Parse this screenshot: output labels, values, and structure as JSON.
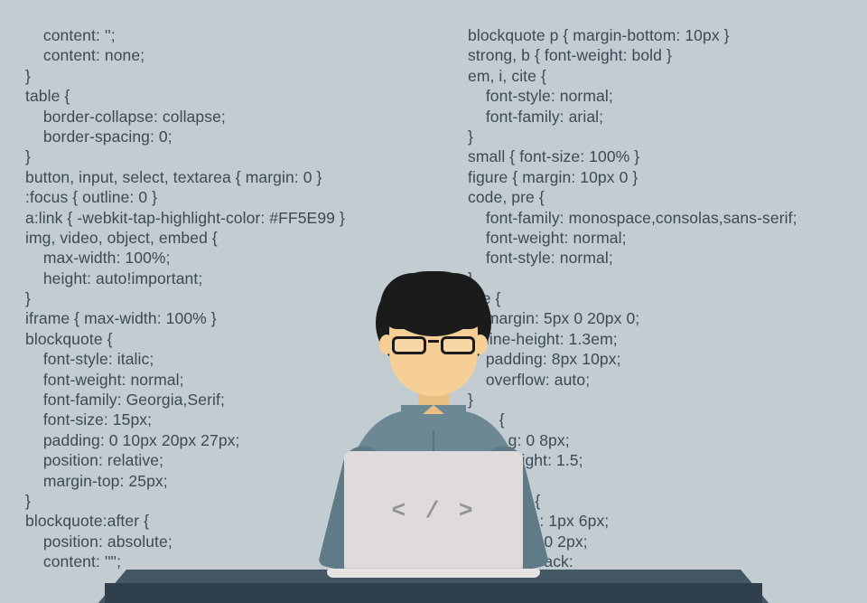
{
  "code": {
    "left": "    content: '';\n    content: none;\n}\ntable {\n    border-collapse: collapse;\n    border-spacing: 0;\n}\nbutton, input, select, textarea { margin: 0 }\n:focus { outline: 0 }\na:link { -webkit-tap-highlight-color: #FF5E99 }\nimg, video, object, embed {\n    max-width: 100%;\n    height: auto!important;\n}\niframe { max-width: 100% }\nblockquote {\n    font-style: italic;\n    font-weight: normal;\n    font-family: Georgia,Serif;\n    font-size: 15px;\n    padding: 0 10px 20px 27px;\n    position: relative;\n    margin-top: 25px;\n}\nblockquote:after {\n    position: absolute;\n    content: '\"';",
    "right": "blockquote p { margin-bottom: 10px }\nstrong, b { font-weight: bold }\nem, i, cite {\n    font-style: normal;\n    font-family: arial;\n}\nsmall { font-size: 100% }\nfigure { margin: 10px 0 }\ncode, pre {\n    font-family: monospace,consolas,sans-serif;\n    font-weight: normal;\n    font-style: normal;\n}\npre {\n    margin: 5px 0 20px 0;\n    line-height: 1.3em;\n    padding: 8px 10px;\n    overflow: auto;\n}\n       {\n         g: 0 8px;\n          eight: 1.5;\n}\n               {\n                : 1px 6px;\n                 0 2px;\n                 ack:"
  },
  "laptop": {
    "logo": "< / >"
  }
}
